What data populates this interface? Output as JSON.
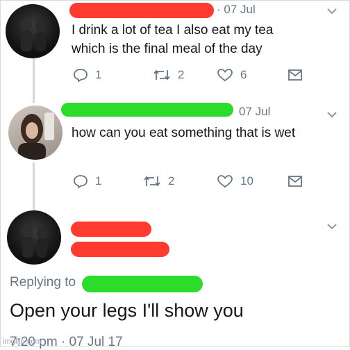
{
  "tweets": [
    {
      "date": "07 Jul",
      "text_lines": [
        "I drink a lot of tea I also eat my tea",
        "which is the final meal of the day"
      ],
      "replies": "1",
      "retweets": "2",
      "likes": "6"
    },
    {
      "date": "07 Jul",
      "text_lines": [
        "how can you eat something that is wet"
      ],
      "replies": "1",
      "retweets": "2",
      "likes": "10"
    }
  ],
  "main_tweet": {
    "replying_to_label": "Replying to",
    "text": "Open your legs I'll show you",
    "timestamp": "7:20 pm · 07 Jul 17"
  },
  "watermark": "imgflip.com",
  "colors": {
    "redaction_red": "#ff3b2f",
    "redaction_green": "#2bdc2b",
    "muted": "#657786"
  },
  "icons": [
    "reply-icon",
    "retweet-icon",
    "like-icon",
    "message-icon",
    "chevron-down-icon"
  ]
}
